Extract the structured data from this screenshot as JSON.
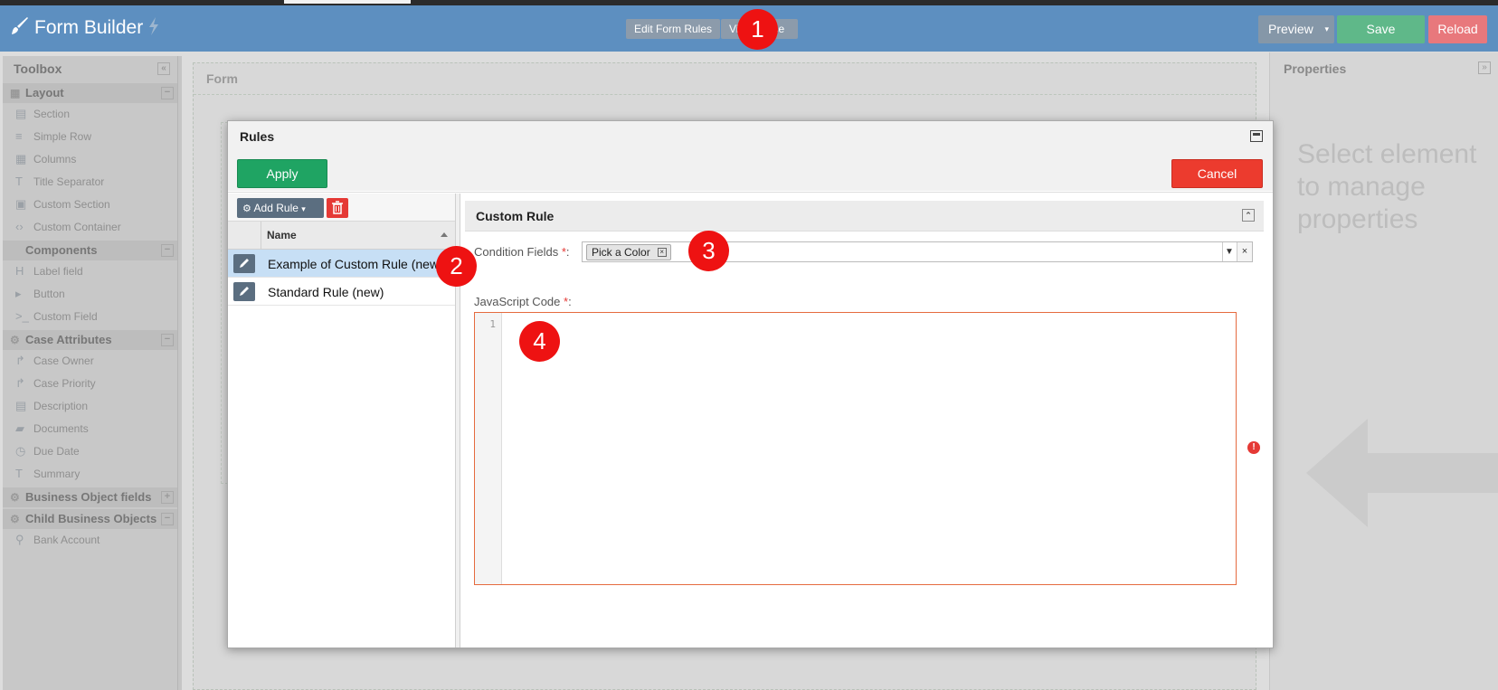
{
  "header": {
    "title": "Form Builder",
    "edit_rules_label": "Edit Form Rules",
    "view_source_label": "Vi",
    "view_source_tail": "ce",
    "preview_label": "Preview",
    "save_label": "Save",
    "reload_label": "Reload"
  },
  "toolbox": {
    "title": "Toolbox",
    "groups": [
      {
        "label": "Layout",
        "items": [
          "Section",
          "Simple Row",
          "Columns",
          "Title Separator",
          "Custom Section",
          "Custom Container"
        ]
      },
      {
        "label": "Components",
        "items": [
          "Label field",
          "Button",
          "Custom Field"
        ]
      },
      {
        "label": "Case Attributes",
        "items": [
          "Case Owner",
          "Case Priority",
          "Description",
          "Documents",
          "Due Date",
          "Summary"
        ]
      },
      {
        "label": "Business Object fields",
        "items": []
      },
      {
        "label": "Child Business Objects",
        "items": [
          "Bank Account"
        ]
      }
    ]
  },
  "form": {
    "label": "Form"
  },
  "properties": {
    "title": "Properties",
    "hint": "Select element to manage properties"
  },
  "modal": {
    "title": "Rules",
    "apply_label": "Apply",
    "cancel_label": "Cancel",
    "add_rule_label": "Add Rule",
    "column_name": "Name",
    "rules": [
      "Example of Custom Rule (new)",
      "Standard Rule (new)"
    ],
    "editor": {
      "section_title": "Custom Rule",
      "condition_label": "Condition Fields",
      "condition_chip": "Pick a Color",
      "js_label": "JavaScript Code",
      "required_mark": "*",
      "colon": ":",
      "line_number": "1"
    }
  },
  "callouts": [
    "1",
    "2",
    "3",
    "4"
  ],
  "colors": {
    "header": "#5d8fc0",
    "apply": "#1fa463",
    "cancel": "#ec3b2e",
    "save": "#5fb889",
    "reload": "#e8787c",
    "callout": "#ee1212"
  }
}
